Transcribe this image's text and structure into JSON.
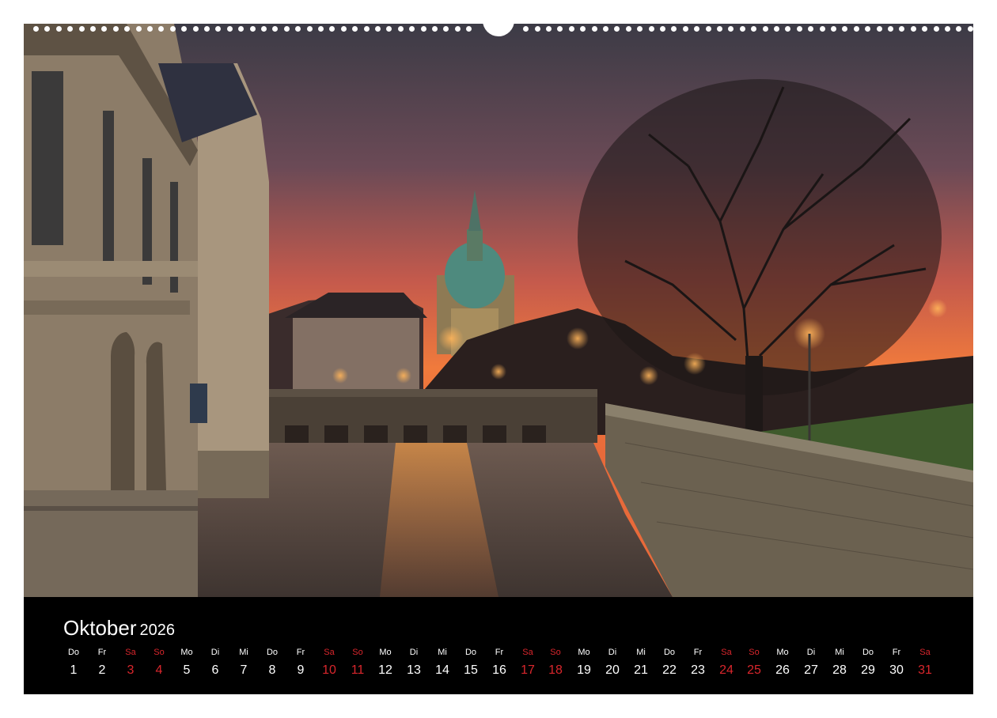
{
  "calendar": {
    "month": "Oktober",
    "year": "2026",
    "days": [
      {
        "wd": "Do",
        "d": "1",
        "weekend": false
      },
      {
        "wd": "Fr",
        "d": "2",
        "weekend": false
      },
      {
        "wd": "Sa",
        "d": "3",
        "weekend": true
      },
      {
        "wd": "So",
        "d": "4",
        "weekend": true
      },
      {
        "wd": "Mo",
        "d": "5",
        "weekend": false
      },
      {
        "wd": "Di",
        "d": "6",
        "weekend": false
      },
      {
        "wd": "Mi",
        "d": "7",
        "weekend": false
      },
      {
        "wd": "Do",
        "d": "8",
        "weekend": false
      },
      {
        "wd": "Fr",
        "d": "9",
        "weekend": false
      },
      {
        "wd": "Sa",
        "d": "10",
        "weekend": true
      },
      {
        "wd": "So",
        "d": "11",
        "weekend": true
      },
      {
        "wd": "Mo",
        "d": "12",
        "weekend": false
      },
      {
        "wd": "Di",
        "d": "13",
        "weekend": false
      },
      {
        "wd": "Mi",
        "d": "14",
        "weekend": false
      },
      {
        "wd": "Do",
        "d": "15",
        "weekend": false
      },
      {
        "wd": "Fr",
        "d": "16",
        "weekend": false
      },
      {
        "wd": "Sa",
        "d": "17",
        "weekend": true
      },
      {
        "wd": "So",
        "d": "18",
        "weekend": true
      },
      {
        "wd": "Mo",
        "d": "19",
        "weekend": false
      },
      {
        "wd": "Di",
        "d": "20",
        "weekend": false
      },
      {
        "wd": "Mi",
        "d": "21",
        "weekend": false
      },
      {
        "wd": "Do",
        "d": "22",
        "weekend": false
      },
      {
        "wd": "Fr",
        "d": "23",
        "weekend": false
      },
      {
        "wd": "Sa",
        "d": "24",
        "weekend": true
      },
      {
        "wd": "So",
        "d": "25",
        "weekend": true
      },
      {
        "wd": "Mo",
        "d": "26",
        "weekend": false
      },
      {
        "wd": "Di",
        "d": "27",
        "weekend": false
      },
      {
        "wd": "Mi",
        "d": "28",
        "weekend": false
      },
      {
        "wd": "Do",
        "d": "29",
        "weekend": false
      },
      {
        "wd": "Fr",
        "d": "30",
        "weekend": false
      },
      {
        "wd": "Sa",
        "d": "31",
        "weekend": true
      }
    ]
  },
  "colors": {
    "weekend": "#d9262c",
    "weekday": "#ffffff",
    "strip_background": "#000000"
  }
}
